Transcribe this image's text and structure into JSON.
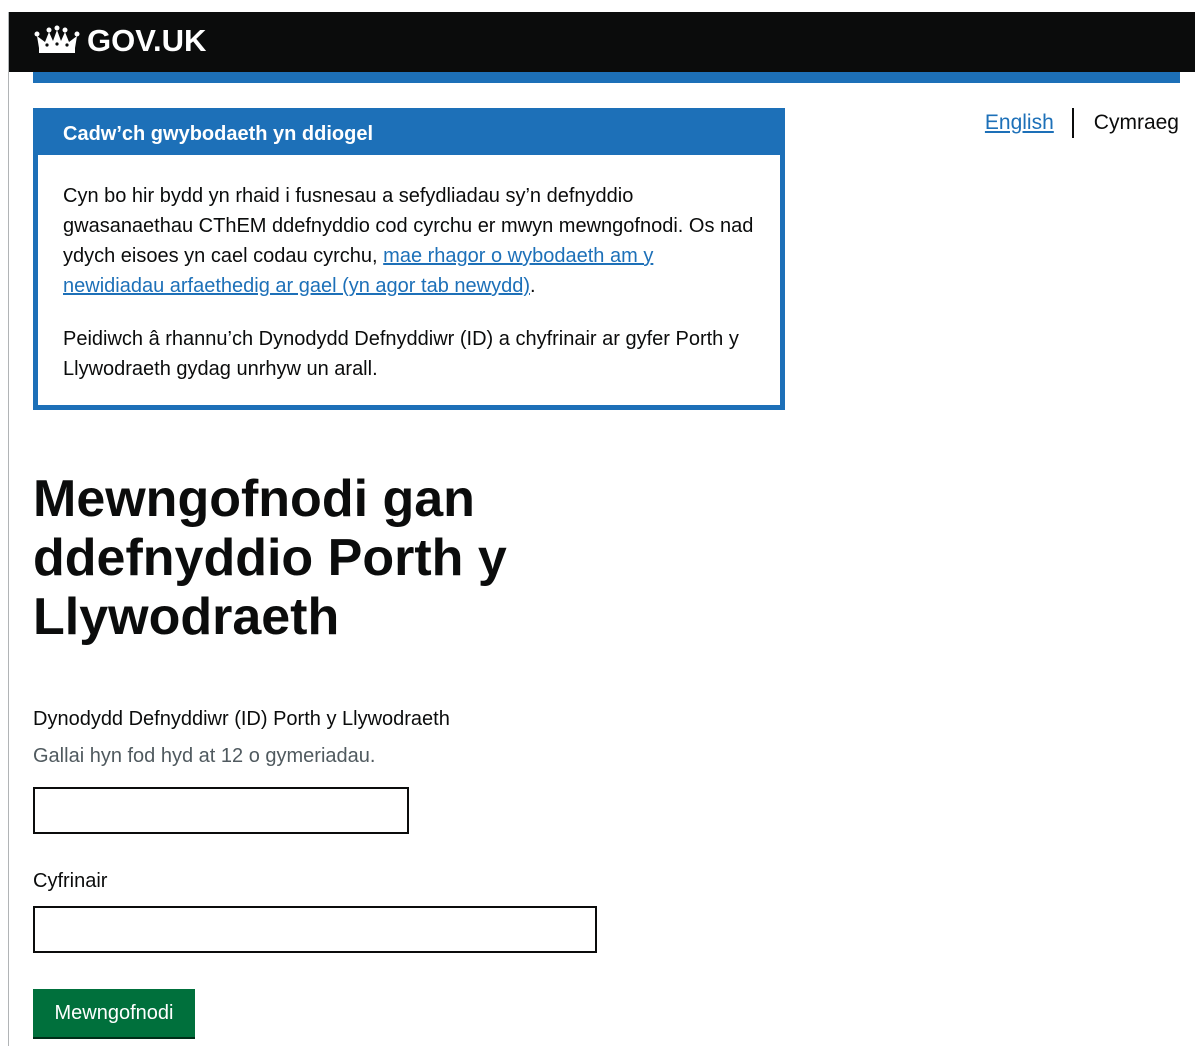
{
  "header": {
    "logo_text": "GOV.UK"
  },
  "language": {
    "english": "English",
    "current": "Cymraeg"
  },
  "banner": {
    "title": "Cadw’ch gwybodaeth yn ddiogel",
    "para1_text": "Cyn bo hir bydd yn rhaid i fusnesau a sefydliadau sy’n defnyddio gwasanaethau CThEM ddefnyddio cod cyrchu er mwyn mewngofnodi. Os nad ydych eisoes yn cael codau cyrchu, ",
    "para1_link": "mae rhagor o wybodaeth am y newidiadau arfaethedig ar gael (yn agor tab newydd)",
    "para1_end": ".",
    "para2": "Peidiwch â rhannu’ch Dynodydd Defnyddiwr (ID) a chyfrinair ar gyfer Porth y Llywodraeth gydag unrhyw un arall."
  },
  "page": {
    "title": "Mewngofnodi gan ddefnyddio Porth y Llywodraeth"
  },
  "form": {
    "user_id_label": "Dynodydd Defnyddiwr (ID) Porth y Llywodraeth",
    "user_id_hint": "Gallai hyn fod hyd at 12 o gymeriadau.",
    "user_id_value": "",
    "password_label": "Cyfrinair",
    "password_value": "",
    "submit_label": "Mewngofnodi"
  },
  "colors": {
    "header_bg": "#0b0c0c",
    "brand_blue": "#1d70b8",
    "button_green": "#00703c",
    "hint_grey": "#505a5f"
  }
}
